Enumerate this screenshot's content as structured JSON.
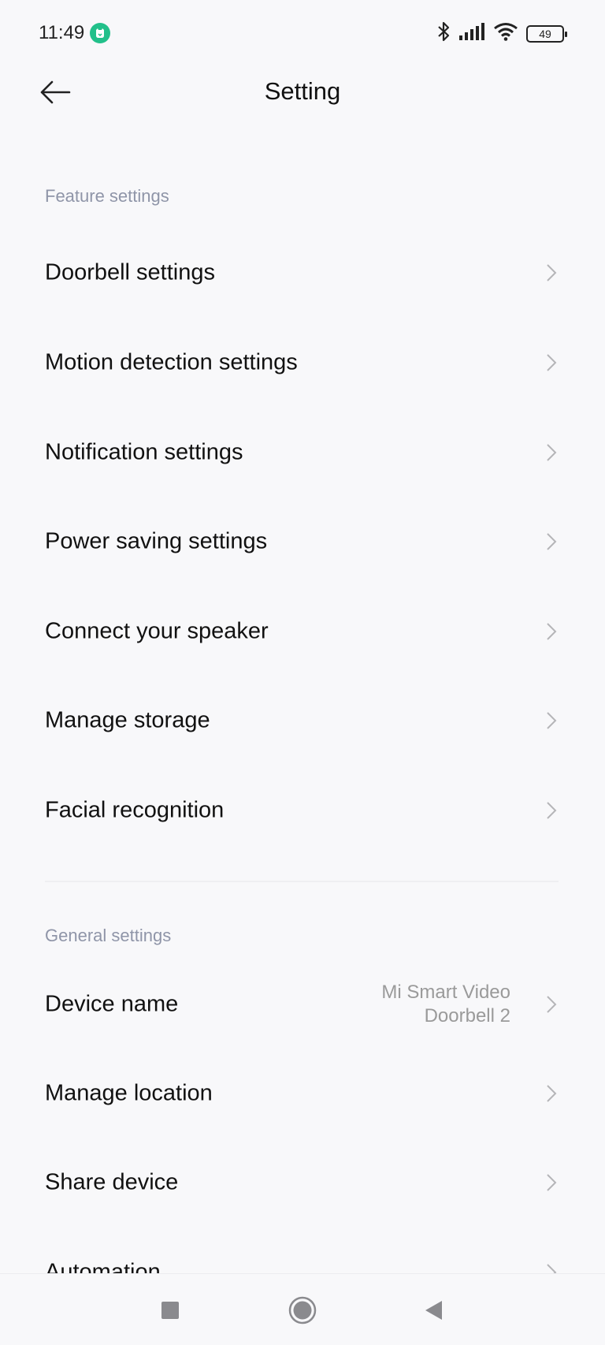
{
  "status_bar": {
    "time": "11:49",
    "battery": "49",
    "app_badge_color": "#22c08a",
    "icons": [
      "bluetooth-icon",
      "signal-icon",
      "wifi-icon",
      "battery-icon"
    ]
  },
  "header": {
    "title": "Setting",
    "back_icon": "arrow-left-icon"
  },
  "feature_section": {
    "label": "Feature settings",
    "items": [
      {
        "label": "Doorbell settings"
      },
      {
        "label": "Motion detection settings"
      },
      {
        "label": "Notification settings"
      },
      {
        "label": "Power saving settings"
      },
      {
        "label": "Connect your speaker"
      },
      {
        "label": "Manage storage"
      },
      {
        "label": "Facial recognition"
      }
    ]
  },
  "general_section": {
    "label": "General settings",
    "items": [
      {
        "label": "Device name",
        "value": "Mi Smart Video Doorbell 2"
      },
      {
        "label": "Manage location"
      },
      {
        "label": "Share device"
      },
      {
        "label": "Automation"
      }
    ]
  },
  "nav_bar": {
    "icons": [
      "recents-square-icon",
      "home-circle-icon",
      "back-triangle-icon"
    ]
  }
}
